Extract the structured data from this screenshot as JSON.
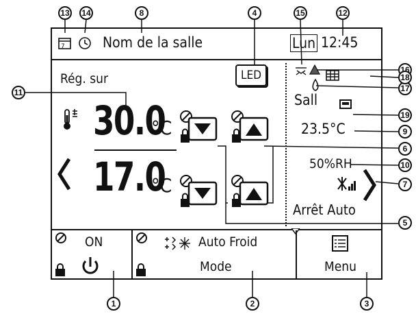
{
  "header": {
    "room_name": "Nom de la salle",
    "day": "Lun",
    "time": "12:45"
  },
  "main": {
    "set_label": "Rég. sur",
    "led_label": "LED",
    "set_temp_cool": "30.0",
    "set_temp_heat": "17.0",
    "unit": "°C"
  },
  "side": {
    "room_label": "Sall",
    "room_temp": "23.5°C",
    "humidity": "50%RH",
    "auto_off": "Arrêt Auto"
  },
  "footer": {
    "onoff_state": "ON",
    "mode_value": "Auto Froid",
    "mode_label": "Mode",
    "menu_label": "Menu"
  },
  "callouts": [
    "1",
    "2",
    "3",
    "4",
    "5",
    "6",
    "7",
    "8",
    "9",
    "10",
    "11",
    "12",
    "13",
    "14",
    "15",
    "16",
    "17",
    "18",
    "19"
  ],
  "icons": {
    "power": "power-icon",
    "mode": "auto-cool-mode-icon",
    "menu": "menu-list-icon",
    "lock": "lock-icon",
    "prohibit": "prohibited-icon",
    "thermometer": "thermometer-icon",
    "clock": "clock-icon",
    "calendar": "weekly-timer-icon",
    "fan": "fan-speed-icon",
    "filter": "filter-icon",
    "vane": "vane-icon",
    "louver": "louver-icon",
    "ventilation": "ventilation-icon",
    "sensor": "sensor-icon"
  }
}
